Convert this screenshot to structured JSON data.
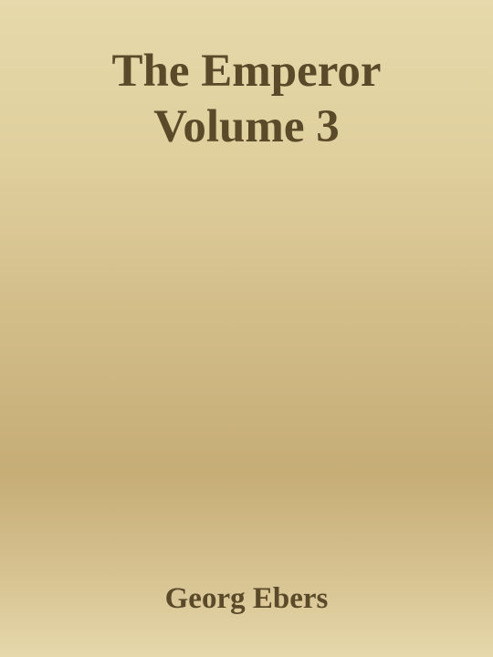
{
  "book": {
    "title_line1": "The Emperor",
    "title_line2": "Volume 3",
    "author": "Georg Ebers"
  },
  "colors": {
    "text": "#5a4a2a",
    "background_top": "#e6d9aa",
    "background_mid": "#c6ad76",
    "background_bottom": "#e6d8ab"
  }
}
